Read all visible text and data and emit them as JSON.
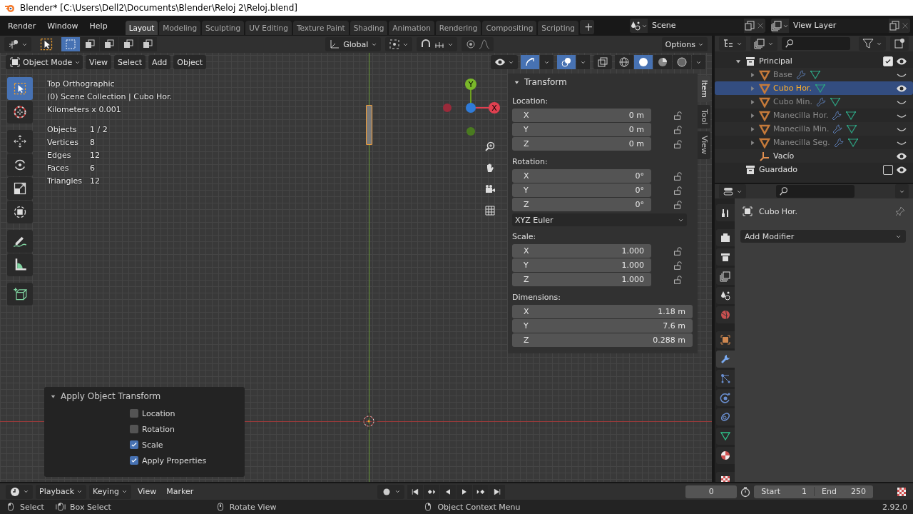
{
  "window": {
    "title": "Blender* [C:\\Users\\Dell2\\Documents\\Blender\\Reloj 2\\Reloj.blend]"
  },
  "menus": [
    "Render",
    "Window",
    "Help"
  ],
  "workspace_tabs": [
    {
      "label": "Layout",
      "selected": true
    },
    {
      "label": "Modeling",
      "selected": false
    },
    {
      "label": "Sculpting",
      "selected": false
    },
    {
      "label": "UV Editing",
      "selected": false
    },
    {
      "label": "Texture Paint",
      "selected": false
    },
    {
      "label": "Shading",
      "selected": false
    },
    {
      "label": "Animation",
      "selected": false
    },
    {
      "label": "Rendering",
      "selected": false
    },
    {
      "label": "Compositing",
      "selected": false
    },
    {
      "label": "Scripting",
      "selected": false
    }
  ],
  "add_workspace": "+",
  "scene": "Scene",
  "view_layer": "View Layer",
  "tool_header": {
    "orientation": "Global",
    "options": "Options"
  },
  "viewport_header": {
    "mode": "Object Mode",
    "menus": [
      "View",
      "Select",
      "Add",
      "Object"
    ]
  },
  "toolbar": [
    {
      "kind": "select",
      "selected": true
    },
    {
      "kind": "cursor",
      "selected": false
    },
    {
      "kind": "move",
      "selected": false
    },
    {
      "kind": "rotate",
      "selected": false
    },
    {
      "kind": "scale",
      "selected": false
    },
    {
      "kind": "transform",
      "selected": false
    },
    {
      "kind": "annotate",
      "selected": false
    },
    {
      "kind": "measure",
      "selected": false
    },
    {
      "kind": "add-cube",
      "selected": false
    }
  ],
  "viewport_info": {
    "lines": [
      "Top Orthographic",
      "(0) Scene Collection | Cubo Hor.",
      "Kilometers x 0.001"
    ],
    "stats": [
      {
        "label": "Objects",
        "value": "1 / 2"
      },
      {
        "label": "Vertices",
        "value": "8"
      },
      {
        "label": "Edges",
        "value": "12"
      },
      {
        "label": "Faces",
        "value": "6"
      },
      {
        "label": "Triangles",
        "value": "12"
      }
    ]
  },
  "gizmo": {
    "x_label": "X",
    "y_label": "Y"
  },
  "transform_panel": {
    "title": "Transform",
    "sections": [
      {
        "label": "Location:",
        "lockable": true,
        "fields": [
          {
            "axis": "X",
            "value": "0 m"
          },
          {
            "axis": "Y",
            "value": "0 m"
          },
          {
            "axis": "Z",
            "value": "0 m"
          }
        ]
      },
      {
        "label": "Rotation:",
        "lockable": true,
        "fields": [
          {
            "axis": "X",
            "value": "0°"
          },
          {
            "axis": "Y",
            "value": "0°"
          },
          {
            "axis": "Z",
            "value": "0°"
          }
        ],
        "mode": "XYZ Euler"
      },
      {
        "label": "Scale:",
        "lockable": true,
        "fields": [
          {
            "axis": "X",
            "value": "1.000"
          },
          {
            "axis": "Y",
            "value": "1.000"
          },
          {
            "axis": "Z",
            "value": "1.000"
          }
        ]
      },
      {
        "label": "Dimensions:",
        "lockable": false,
        "fields": [
          {
            "axis": "X",
            "value": "1.18 m"
          },
          {
            "axis": "Y",
            "value": "7.6 m"
          },
          {
            "axis": "Z",
            "value": "0.288 m"
          }
        ]
      }
    ]
  },
  "sidebar_tabs": [
    {
      "label": "Item",
      "selected": true
    },
    {
      "label": "Tool",
      "selected": false
    },
    {
      "label": "View",
      "selected": false
    }
  ],
  "operator_panel": {
    "title": "Apply Object Transform",
    "options": [
      {
        "label": "Location",
        "checked": false
      },
      {
        "label": "Rotation",
        "checked": false
      },
      {
        "label": "Scale",
        "checked": true
      },
      {
        "label": "Apply Properties",
        "checked": true
      }
    ]
  },
  "outliner": {
    "items": [
      {
        "name": "Principal",
        "kind": "collection",
        "selected": false,
        "expanded": true,
        "checked": true,
        "visible": true,
        "children": [
          {
            "name": "Base",
            "kind": "mesh",
            "selected": false,
            "expanded": false,
            "visible": false,
            "modifier": true
          },
          {
            "name": "Cubo Hor.",
            "kind": "mesh",
            "selected": true,
            "expanded": false,
            "visible": true,
            "modifier": false
          },
          {
            "name": "Cubo Min.",
            "kind": "mesh",
            "selected": false,
            "expanded": false,
            "visible": false,
            "modifier": true
          },
          {
            "name": "Manecilla Hor.",
            "kind": "mesh",
            "selected": false,
            "expanded": false,
            "visible": false,
            "modifier": true
          },
          {
            "name": "Manecilla Min.",
            "kind": "mesh",
            "selected": false,
            "expanded": false,
            "visible": false,
            "modifier": true
          },
          {
            "name": "Manecilla Seg.",
            "kind": "mesh",
            "selected": false,
            "expanded": false,
            "visible": false,
            "modifier": true
          },
          {
            "name": "Vacío",
            "kind": "empty",
            "selected": false,
            "visible": true
          }
        ]
      },
      {
        "name": "Guardado",
        "kind": "collection",
        "selected": false,
        "checked": false,
        "visible": true
      }
    ]
  },
  "properties": {
    "object_name": "Cubo Hor.",
    "add_modifier": "Add Modifier",
    "tabs": [
      {
        "kind": "tool",
        "selected": false
      },
      {
        "kind": "render",
        "selected": false
      },
      {
        "kind": "output",
        "selected": false
      },
      {
        "kind": "view-layer",
        "selected": false
      },
      {
        "kind": "scene",
        "selected": false
      },
      {
        "kind": "world",
        "selected": false
      },
      {
        "kind": "object",
        "selected": false
      },
      {
        "kind": "modifiers",
        "selected": true
      },
      {
        "kind": "particles",
        "selected": false
      },
      {
        "kind": "physics",
        "selected": false
      },
      {
        "kind": "constraints",
        "selected": false
      },
      {
        "kind": "data",
        "selected": false
      },
      {
        "kind": "material",
        "selected": false
      },
      {
        "kind": "texture",
        "selected": false
      }
    ]
  },
  "timeline": {
    "menus": [
      "Playback",
      "Keying",
      "View",
      "Marker"
    ],
    "current_frame": "0",
    "start_label": "Start",
    "start": "1",
    "end_label": "End",
    "end": "250"
  },
  "status_bar": {
    "hints": [
      {
        "kind": "left",
        "label": "Select"
      },
      {
        "kind": "left-drag",
        "label": "Box Select"
      },
      {
        "kind": "middle",
        "label": "Rotate View"
      },
      {
        "kind": "right",
        "label": "Object Context Menu"
      }
    ],
    "version": "2.92.0"
  }
}
